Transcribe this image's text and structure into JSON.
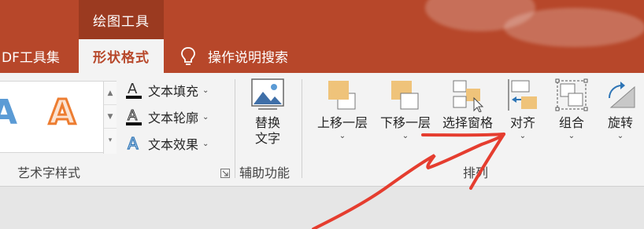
{
  "context_tab": {
    "label": "绘图工具"
  },
  "tabs": {
    "pdf": "DF工具集",
    "shape_format": "形状格式",
    "tell_me": "操作说明搜索"
  },
  "wordart": {
    "text_fill": "文本填充",
    "text_outline": "文本轮廓",
    "text_effects": "文本效果",
    "group_label": "艺术字样式",
    "sample_letter": "A"
  },
  "accessibility": {
    "alt_text_line1": "替换",
    "alt_text_line2": "文字",
    "group_label": "辅助功能"
  },
  "arrange": {
    "bring_forward": "上移一层",
    "send_backward": "下移一层",
    "selection_pane": "选择窗格",
    "align": "对齐",
    "group": "组合",
    "rotate": "旋转",
    "group_label": "排列"
  },
  "colors": {
    "accent": "#b7472a",
    "ribbon_bg": "#f3f3f3",
    "annotation": "#e53d2f"
  }
}
